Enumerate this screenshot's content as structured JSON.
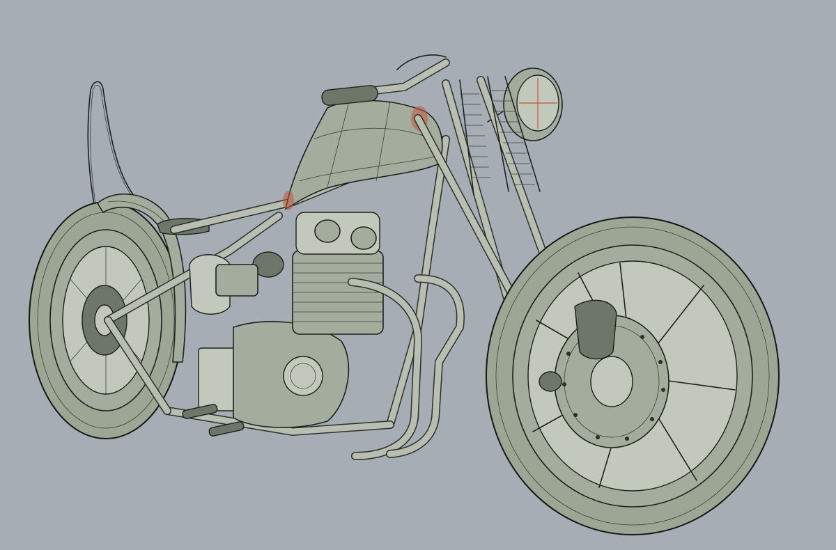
{
  "scene": {
    "background_color": "#a6adb5",
    "model_color": "#a4ac9e",
    "edge_color": "#1c201c",
    "accent_color": "#c0583a"
  }
}
